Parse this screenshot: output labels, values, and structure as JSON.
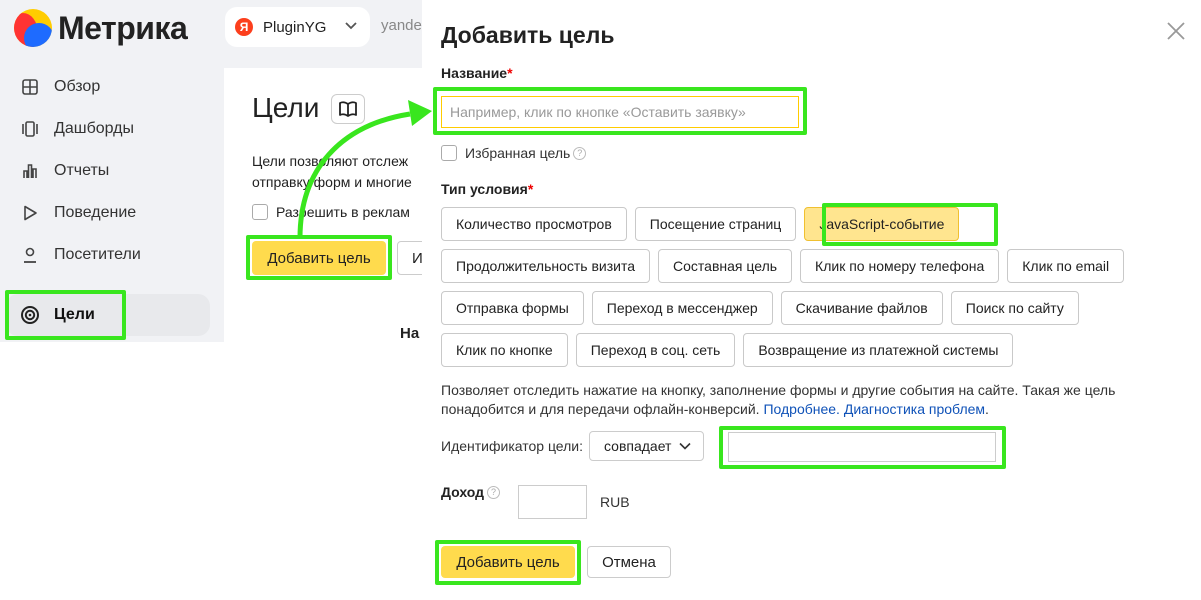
{
  "app": {
    "logo_text": "Метрика"
  },
  "counter": {
    "badge": "Я",
    "name": "PluginYG",
    "url_fragment": "yande"
  },
  "sidebar": {
    "items": [
      {
        "label": "Обзор",
        "icon": "grid-icon"
      },
      {
        "label": "Дашборды",
        "icon": "dashboards-icon"
      },
      {
        "label": "Отчеты",
        "icon": "bar-chart-icon"
      },
      {
        "label": "Поведение",
        "icon": "play-icon"
      },
      {
        "label": "Посетители",
        "icon": "person-icon"
      },
      {
        "label": "Цели",
        "icon": "target-icon",
        "active": true
      }
    ]
  },
  "goals_page": {
    "title": "Цели",
    "description_line1": "Цели позволяют отслеж",
    "description_line2": "отправку форм и многие",
    "allow_label": "Разрешить в реклам",
    "add_button": "Добавить цель",
    "second_button": "И",
    "fragment": "На"
  },
  "modal": {
    "title": "Добавить цель",
    "name_label": "Название",
    "required_mark": "*",
    "name_placeholder": "Например, клик по кнопке «Оставить заявку»",
    "favorite_label": "Избранная цель",
    "help_mark": "?",
    "condition_label": "Тип условия",
    "condition_types": [
      [
        "Количество просмотров",
        "Посещение страниц",
        "JavaScript-событие"
      ],
      [
        "Продолжительность визита",
        "Составная цель",
        "Клик по номеру телефона",
        "Клик по email"
      ],
      [
        "Отправка формы",
        "Переход в мессенджер",
        "Скачивание файлов",
        "Поиск по сайту"
      ],
      [
        "Клик по кнопке",
        "Переход в соц. сеть",
        "Возвращение из платежной системы"
      ]
    ],
    "selected_type": "JavaScript-событие",
    "help_text": "Позволяет отследить нажатие на кнопку, заполнение формы и другие события на сайте. Такая же цель понадобится и для передачи офлайн-конверсий.",
    "link_more": "Подробнее.",
    "link_diag": "Диагностика проблем",
    "id_label": "Идентификатор цели:",
    "match_option": "совпадает",
    "id_value": "",
    "income_label": "Доход",
    "income_value": "",
    "currency": "RUB",
    "submit": "Добавить цель",
    "cancel": "Отмена"
  },
  "colors": {
    "accent_yellow": "#ffdb4d",
    "highlight_green": "#39e61e",
    "link": "#0f52b8"
  }
}
